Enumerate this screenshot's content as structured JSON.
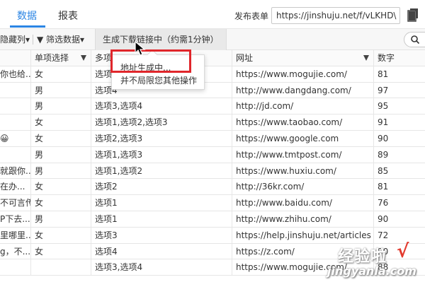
{
  "tabs": {
    "data": "数据",
    "report": "报表"
  },
  "form": {
    "label": "发布表单",
    "url": "https://jinshuju.net/f/vLKHD\\"
  },
  "toolbar": {
    "hidden_cols": "隐藏列▾",
    "filter": "▼ 筛选数据▾",
    "generate": "生成下载链接中（约需1分钟）"
  },
  "popup": {
    "line1": "地址生成中...",
    "line2": "并不局限您其他操作"
  },
  "table": {
    "headers": [
      "",
      "单项选择",
      "多项",
      "网址",
      "数字"
    ],
    "rows": [
      [
        "你也给...",
        "女",
        "选项3",
        "https://www.mogujie.com/",
        "81"
      ],
      [
        "",
        "男",
        "选项4",
        "http://www.dangdang.com/",
        "97"
      ],
      [
        "",
        "男",
        "选项3,选项4",
        "http://jd.com/",
        "95"
      ],
      [
        "",
        "女",
        "选项1,选项2,选项3",
        "https://www.taobao.com/",
        "91"
      ],
      [
        "😀",
        "女",
        "选项2,选项3",
        "https://www.google.com",
        "90"
      ],
      [
        "",
        "男",
        "选项1,选项3",
        "http://www.tmtpost.com/",
        "89"
      ],
      [
        "就跟你...",
        "男",
        "选项1,选项2",
        "https://www.huxiu.com/",
        "85"
      ],
      [
        "在办...",
        "女",
        "选项2",
        "http://36kr.com/",
        "81"
      ],
      [
        "不可言传",
        "女",
        "选项1",
        "http://www.baidu.com/",
        "76"
      ],
      [
        "P下去...",
        "男",
        "选项1",
        "http://www.zhihu.com/",
        "90"
      ],
      [
        "里哪里...",
        "女",
        "选项3",
        "https://help.jinshuju.net/articles",
        "72"
      ],
      [
        "g，不...",
        "女",
        "选项4",
        "https://z.com/",
        "90"
      ],
      [
        "",
        "",
        "选项3,选项4",
        "https://www.mogujie.com/",
        "88"
      ]
    ]
  },
  "watermark": {
    "cn": "经验啦",
    "check": "√",
    "url": "jingyanla.com"
  },
  "colors": {
    "accent": "#2b85e4",
    "highlight": "#e0262b"
  }
}
